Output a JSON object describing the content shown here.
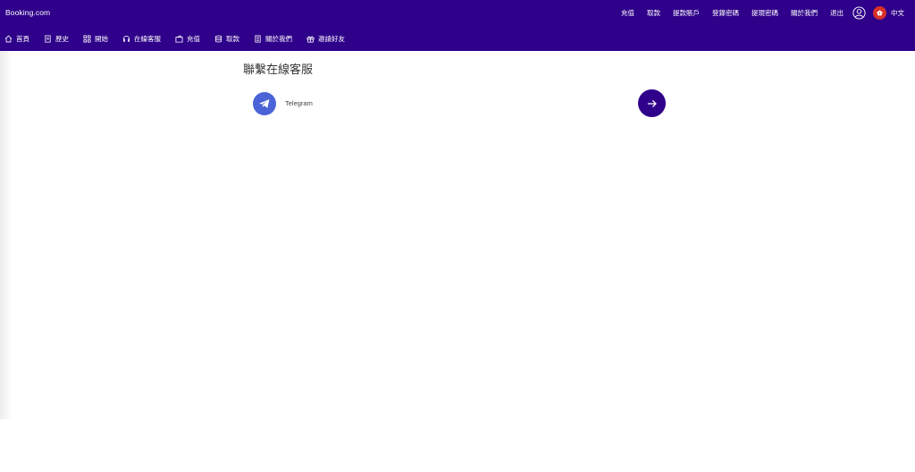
{
  "header": {
    "brand": "Booking.com",
    "top_links": [
      "充值",
      "取款",
      "提款賬戶",
      "登錄密碼",
      "提現密碼",
      "關於我們",
      "退出"
    ],
    "language": "中文"
  },
  "nav": {
    "items": [
      {
        "label": "首頁",
        "icon": "home-icon"
      },
      {
        "label": "歷史",
        "icon": "document-icon"
      },
      {
        "label": "開始",
        "icon": "grid-icon"
      },
      {
        "label": "在線客服",
        "icon": "headset-icon"
      },
      {
        "label": "充值",
        "icon": "wallet-icon"
      },
      {
        "label": "取款",
        "icon": "database-icon"
      },
      {
        "label": "關於我們",
        "icon": "info-doc-icon"
      },
      {
        "label": "邀請好友",
        "icon": "gift-icon"
      }
    ]
  },
  "main": {
    "title": "聯繫在線客服",
    "contacts": [
      {
        "label": "Telegram",
        "icon": "telegram-icon"
      }
    ]
  },
  "colors": {
    "header_bg": "#2f008a",
    "telegram_blue": "#4a63d6",
    "flag_red": "#d8302a"
  }
}
